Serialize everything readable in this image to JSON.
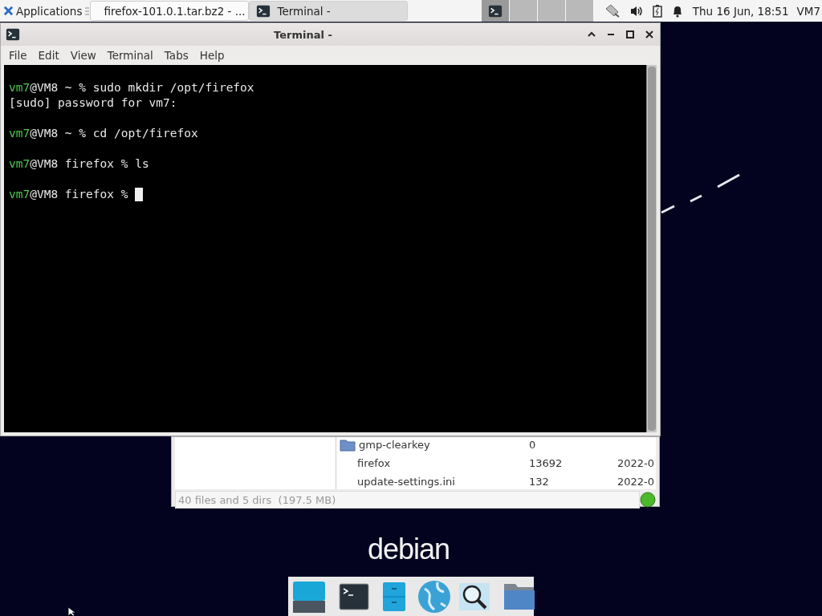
{
  "panel": {
    "menu_label": "Applications",
    "tasks": [
      {
        "label": "firefox-101.0.1.tar.bz2 - ...",
        "kind": "archive",
        "selected": false
      },
      {
        "label": "Terminal -",
        "kind": "terminal",
        "selected": true
      }
    ],
    "workspaces": [
      {
        "selected": true
      },
      {
        "selected": false
      },
      {
        "selected": false
      },
      {
        "selected": false
      }
    ],
    "clock": "Thu 16 Jun, 18:51",
    "user": "VM7"
  },
  "terminal": {
    "title": "Terminal -",
    "menu": [
      "File",
      "Edit",
      "View",
      "Terminal",
      "Tabs",
      "Help"
    ],
    "lines": [
      {
        "kind": "prompt",
        "user": "vm7",
        "text": "@VM8 ~ % sudo mkdir /opt/firefox",
        "cursor": false
      },
      {
        "kind": "output",
        "text": "[sudo] password for vm7:",
        "cursor": false
      },
      {
        "kind": "blank"
      },
      {
        "kind": "prompt",
        "user": "vm7",
        "text": "@VM8 ~ % cd /opt/firefox",
        "cursor": false
      },
      {
        "kind": "blank"
      },
      {
        "kind": "prompt",
        "user": "vm7",
        "text": "@VM8 firefox % ls",
        "cursor": false
      },
      {
        "kind": "blank"
      },
      {
        "kind": "prompt",
        "user": "vm7",
        "text": "@VM8 firefox % ",
        "cursor": true
      }
    ]
  },
  "file_manager": {
    "rows": [
      {
        "kind": "folder",
        "name": "gmp-clearkey",
        "size": "0"
      },
      {
        "kind": "file",
        "name": "firefox",
        "size": "13692",
        "column_3": "2022-0"
      },
      {
        "kind": "file",
        "name": "update-settings.ini",
        "size": "132",
        "column_3": "2022-0"
      }
    ],
    "status": "40 files and 5 dirs  (197.5 MB)"
  },
  "logo": "debian"
}
